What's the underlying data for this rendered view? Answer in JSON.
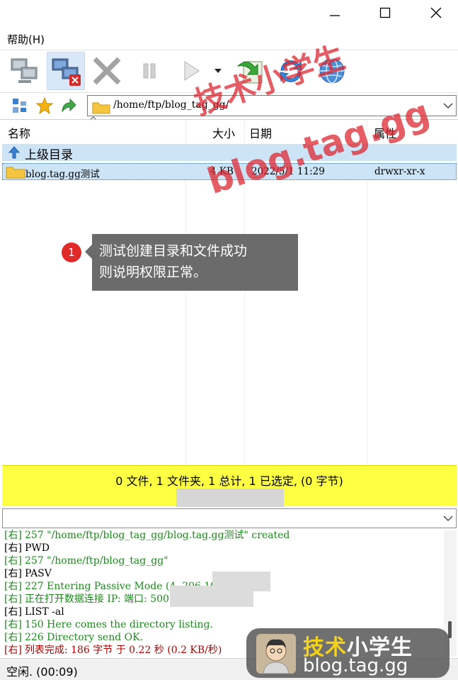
{
  "menu": {
    "help": "帮助(H)"
  },
  "address": {
    "path": "/home/ftp/blog_tag_gg/"
  },
  "columns": {
    "name": "名称",
    "size": "大小",
    "date": "日期",
    "attr": "属性"
  },
  "rows": [
    {
      "name": "上级目录",
      "size": "",
      "date": "",
      "attr": ""
    },
    {
      "name": "blog.tag.gg测试",
      "size": "4 KB",
      "date": "2022/5/1 11:29",
      "attr": "drwxr-xr-x"
    }
  ],
  "annotation": {
    "number": "1",
    "text_line1": "测试创建目录和文件成功",
    "text_line2": "则说明权限正常。"
  },
  "watermark": {
    "line1": "技术小学生",
    "line2": "blog.tag.gg"
  },
  "summary": "0 文件, 1 文件夹, 1 总计, 1 已选定, (0 字节)",
  "log": [
    {
      "tag": "[右]",
      "text": "257 \"/home/ftp/blog_tag_gg/blog.tag.gg测试\" created",
      "color": "green"
    },
    {
      "tag": "[右]",
      "text": "PWD",
      "color": "black"
    },
    {
      "tag": "[右]",
      "text": "257 \"/home/ftp/blog_tag_gg\"",
      "color": "green"
    },
    {
      "tag": "[右]",
      "text": "PASV",
      "color": "black"
    },
    {
      "tag": "[右]",
      "text": "227 Entering Passive Mode (4          ,206,195,88).",
      "color": "green"
    },
    {
      "tag": "[右]",
      "text": "正在打开数据连接 IP:                  端口: 50008",
      "color": "green"
    },
    {
      "tag": "[右]",
      "text": "LIST -al",
      "color": "black"
    },
    {
      "tag": "[右]",
      "text": "150 Here comes the directory listing.",
      "color": "green"
    },
    {
      "tag": "[右]",
      "text": "226 Directory send OK.",
      "color": "green"
    },
    {
      "tag": "[右]",
      "text": "列表完成: 186 字节 于 0.22 秒 (0.2 KB/秒)",
      "color": "red"
    }
  ],
  "status": "空闲. (00:09)",
  "logo": {
    "cn_yellow": "技术",
    "cn_white": "小学生",
    "url": "blog.tag.gg"
  },
  "colors": {
    "selection": "#cde4f7",
    "summary_bg": "#ffff44",
    "tooltip_bg": "#6b6b6b",
    "badge": "#e02a2a",
    "log_green": "#1a8a1a",
    "log_red": "#b00000"
  }
}
